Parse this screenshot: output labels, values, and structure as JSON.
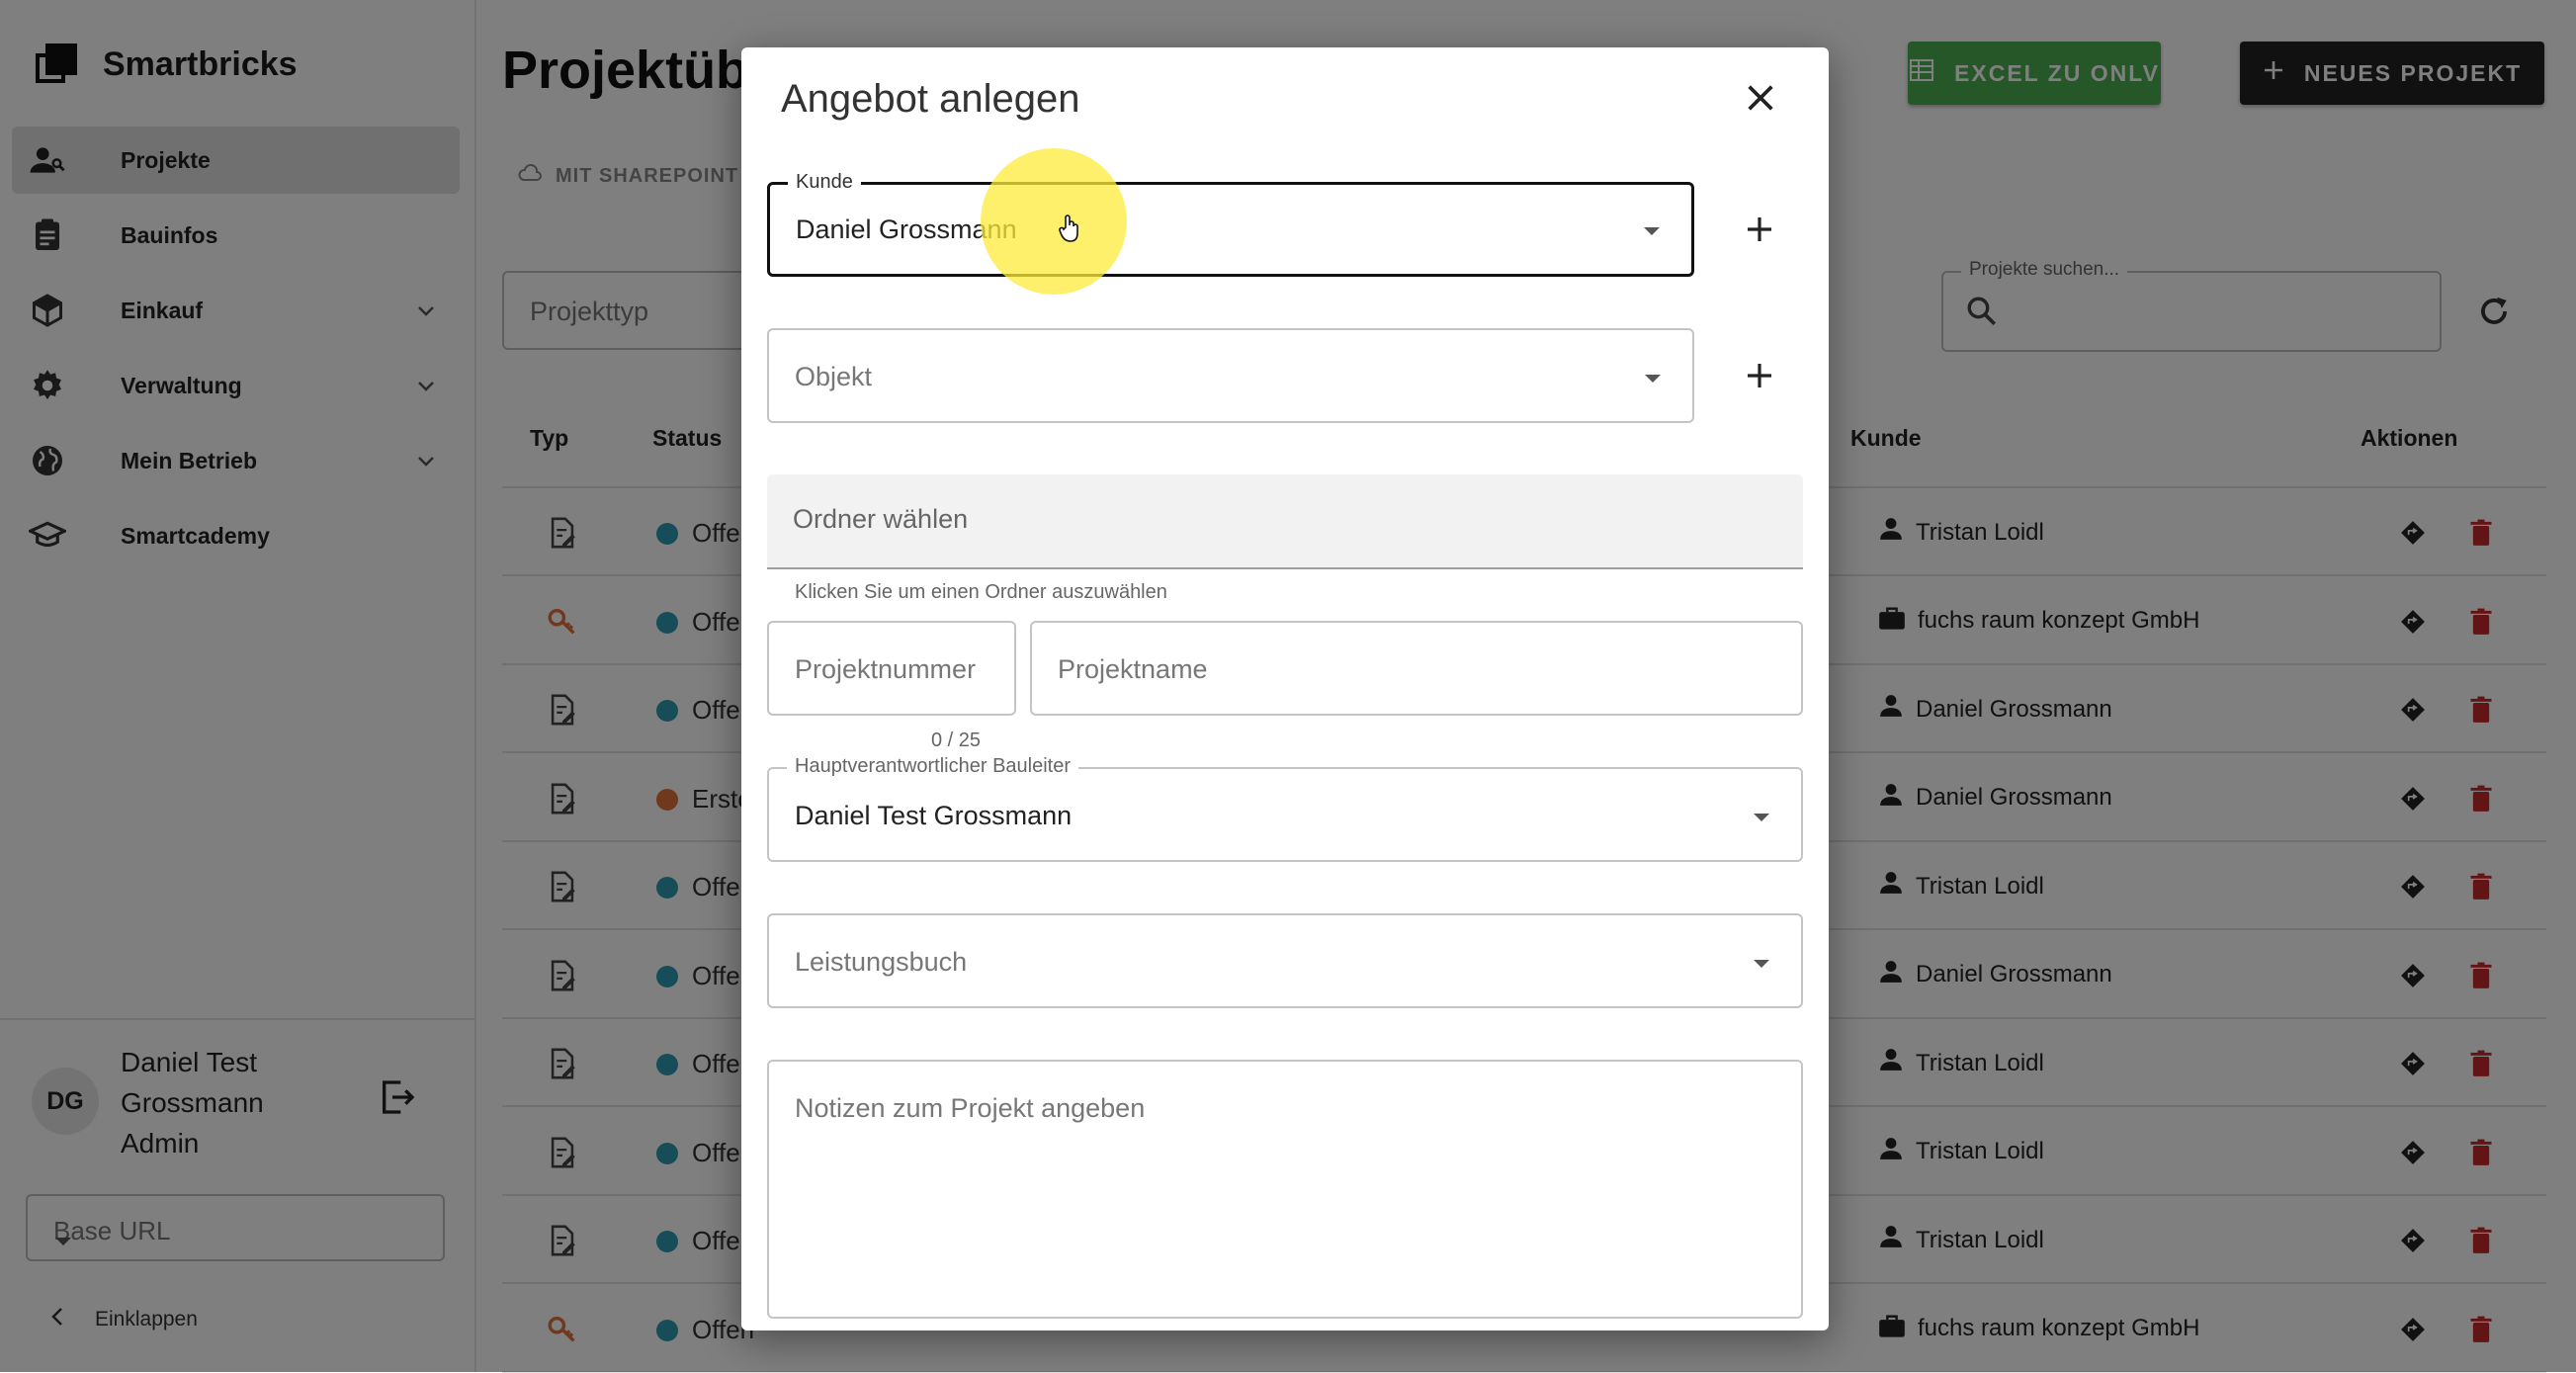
{
  "sidebar": {
    "brand": "Smartbricks",
    "items": [
      {
        "label": "Projekte",
        "icon": "user-icon",
        "active": true
      },
      {
        "label": "Bauinfos",
        "icon": "clipboard-icon"
      },
      {
        "label": "Einkauf",
        "icon": "cube-icon",
        "expandable": true
      },
      {
        "label": "Verwaltung",
        "icon": "gear-icon",
        "expandable": true
      },
      {
        "label": "Mein Betrieb",
        "icon": "globe-icon",
        "expandable": true
      },
      {
        "label": "Smartcademy",
        "icon": "graduation-cap-icon"
      }
    ],
    "user": {
      "initials": "DG",
      "line1": "Daniel Test",
      "line2": "Grossmann",
      "role": "Admin"
    },
    "base_url_placeholder": "Base URL",
    "collapse_label": "Einklappen"
  },
  "main": {
    "title": "Projektübersicht",
    "sharepoint_label": "MIT SHAREPOINT",
    "excel_button": "EXCEL ZU ONLV",
    "new_project_button": "NEUES PROJEKT",
    "project_type_placeholder": "Projekttyp",
    "search_legend": "Projekte suchen...",
    "columns": {
      "typ": "Typ",
      "status": "Status",
      "kunde": "Kunde",
      "aktionen": "Aktionen"
    },
    "rows": [
      {
        "type": "doc",
        "status": "Offen",
        "status_color": "#2e9bb0",
        "kunde": "Tristan Loidl",
        "kunde_type": "person"
      },
      {
        "type": "key",
        "status": "Offen",
        "status_color": "#2e9bb0",
        "kunde": "fuchs raum konzept GmbH",
        "kunde_type": "company"
      },
      {
        "type": "doc",
        "status": "Offen",
        "status_color": "#2e9bb0",
        "kunde": "Daniel Grossmann",
        "kunde_type": "person"
      },
      {
        "type": "doc",
        "status": "Erstellt",
        "status_color": "#e0703a",
        "kunde": "Daniel Grossmann",
        "kunde_type": "person"
      },
      {
        "type": "doc",
        "status": "Offen",
        "status_color": "#2e9bb0",
        "kunde": "Tristan Loidl",
        "kunde_type": "person"
      },
      {
        "type": "doc",
        "status": "Offen",
        "status_color": "#2e9bb0",
        "kunde": "Daniel Grossmann",
        "kunde_type": "person"
      },
      {
        "type": "doc",
        "status": "Offen",
        "status_color": "#2e9bb0",
        "kunde": "Tristan Loidl",
        "kunde_type": "person"
      },
      {
        "type": "doc",
        "status": "Offen",
        "status_color": "#2e9bb0",
        "kunde": "Tristan Loidl",
        "kunde_type": "person"
      },
      {
        "type": "doc",
        "status": "Offen",
        "status_color": "#2e9bb0",
        "kunde": "Tristan Loidl",
        "kunde_type": "person"
      },
      {
        "type": "key",
        "status": "Offen",
        "status_color": "#2e9bb0",
        "kunde": "fuchs raum konzept GmbH",
        "kunde_type": "company"
      }
    ]
  },
  "dialog": {
    "title": "Angebot anlegen",
    "kunde_legend": "Kunde",
    "kunde_value": "Daniel Grossmann",
    "objekt_placeholder": "Objekt",
    "folder_placeholder": "Ordner wählen",
    "folder_helper": "Klicken Sie um einen Ordner auszuwählen",
    "projektnummer_placeholder": "Projektnummer",
    "projektname_placeholder": "Projektname",
    "counter": "0 / 25",
    "bauleiter_legend": "Hauptverantwortlicher Bauleiter",
    "bauleiter_value": "Daniel Test Grossmann",
    "leistungsbuch_placeholder": "Leistungsbuch",
    "notes_placeholder": "Notizen zum Projekt angeben"
  },
  "colors": {
    "accent_green": "#4caf50",
    "dark_button": "#222222",
    "delete_red": "#c62828",
    "cursor_highlight": "#ffeb3b"
  }
}
